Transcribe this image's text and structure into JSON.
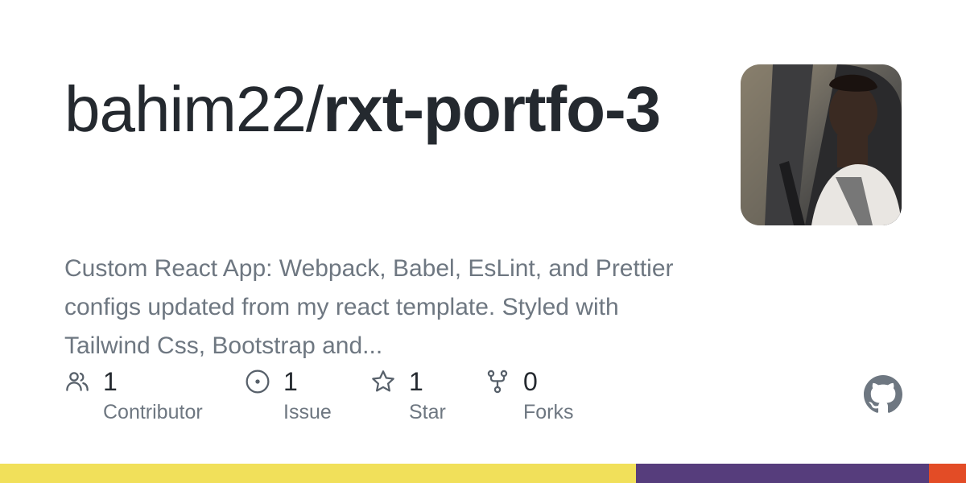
{
  "repo": {
    "owner": "bahim22/",
    "name": "rxt-portfo-3",
    "description": "Custom React App: Webpack, Babel, EsLint, and Prettier configs updated from my react template. Styled with Tailwind Css, Bootstrap and..."
  },
  "stats": {
    "contributors": {
      "count": "1",
      "label": "Contributor",
      "icon": "people-icon"
    },
    "issues": {
      "count": "1",
      "label": "Issue",
      "icon": "issue-opened-icon"
    },
    "stars": {
      "count": "1",
      "label": "Star",
      "icon": "star-icon"
    },
    "forks": {
      "count": "0",
      "label": "Forks",
      "icon": "repo-forked-icon"
    }
  },
  "colors": {
    "text_primary": "#24292f",
    "text_secondary": "#6e7781",
    "icon": "#57606a",
    "github_logo": "#6e7781"
  },
  "language_bar": [
    {
      "color": "#f1e05a",
      "share": 0.658
    },
    {
      "color": "#563d7c",
      "share": 0.304
    },
    {
      "color": "#e34c26",
      "share": 0.038
    }
  ]
}
